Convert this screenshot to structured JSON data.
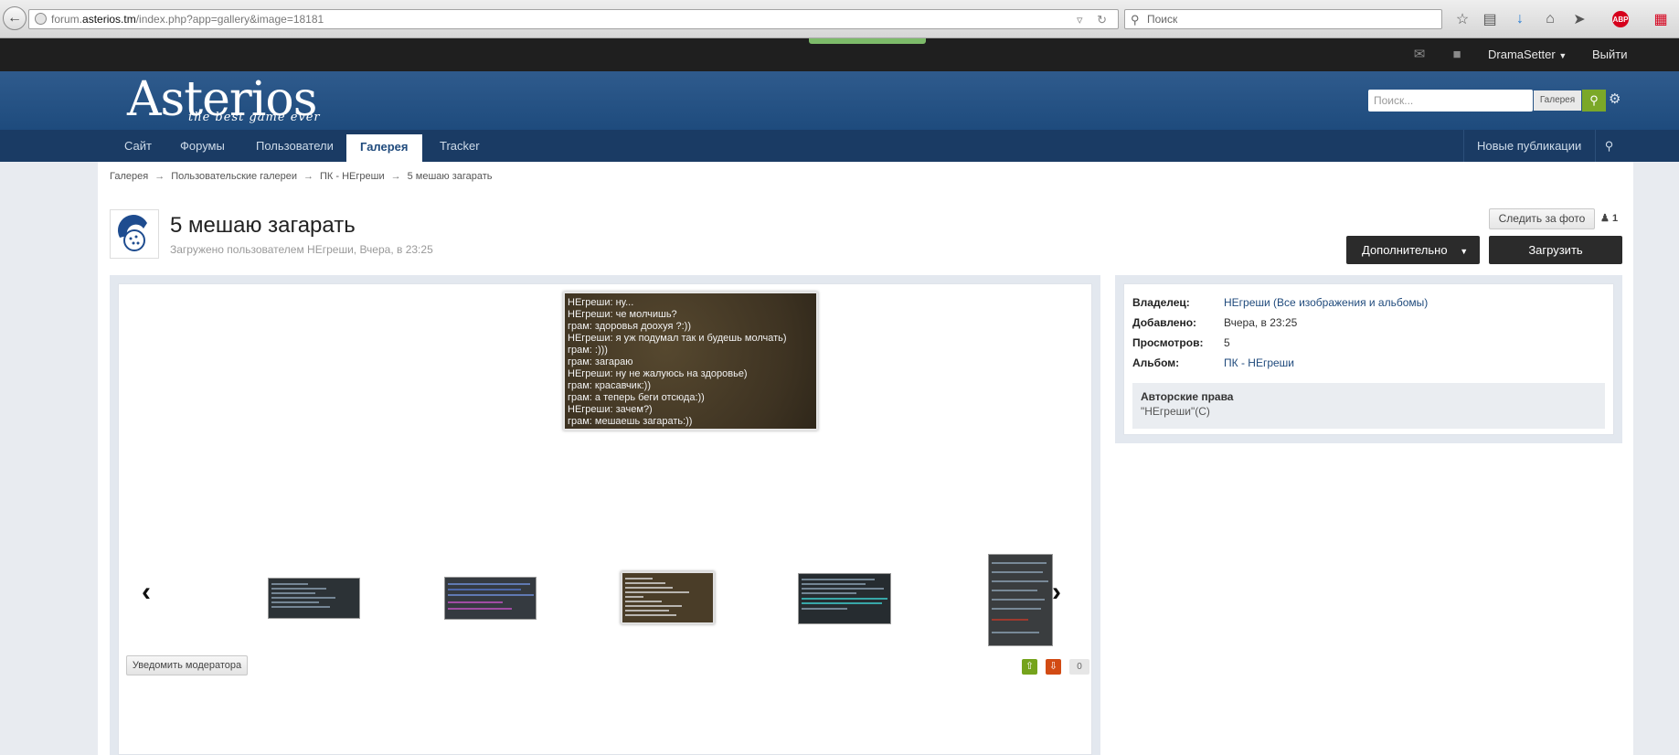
{
  "browser": {
    "url_prefix": "forum.",
    "url_host": "asterios.tm",
    "url_path": "/index.php?app=gallery&image=18181",
    "search_placeholder": "Поиск"
  },
  "userbar": {
    "username": "DramaSetter",
    "logout": "Выйти"
  },
  "header": {
    "logo_text": "Asterios",
    "logo_tagline": "the best game ever",
    "search_placeholder": "Поиск...",
    "search_scope": "Галерея"
  },
  "nav": {
    "items": [
      "Сайт",
      "Форумы",
      "Пользователи",
      "Галерея",
      "Tracker"
    ],
    "active": "Галерея",
    "right_label": "Новые публикации"
  },
  "breadcrumb": [
    "Галерея",
    "Пользовательские галереи",
    "ПК - НЕгреши",
    "5 мешаю загарать"
  ],
  "page": {
    "title": "5 мешаю загарать",
    "subtitle": "Загружено пользователем НЕгреши, Вчера, в 23:25",
    "follow_button": "Следить за фото",
    "followers_count": "1",
    "more_button": "Дополнительно",
    "upload_button": "Загрузить"
  },
  "image": {
    "chat_lines": [
      "НЕгреши: ну...",
      "НЕгреши: че молчишь?",
      "грам: здоровья доохуя ?:))",
      "НЕгреши: я уж подумал так и будешь молчать)",
      "грам: :)))",
      "грам: загараю",
      "НЕгреши: ну не жалуюсь на здоровье)",
      "грам: красавчик:))",
      "грам: а теперь беги отсюда:))",
      "НЕгреши: зачем?)",
      "грам: мешаешь загарать:))"
    ]
  },
  "actions": {
    "report_button": "Уведомить модератора",
    "reputation": "0"
  },
  "info": {
    "owner_label": "Владелец:",
    "owner_value": "НЕгреши (Все изображения и альбомы)",
    "added_label": "Добавлено:",
    "added_value": "Вчера, в 23:25",
    "views_label": "Просмотров:",
    "views_value": "5",
    "album_label": "Альбом:",
    "album_value": "ПК - НЕгреши",
    "copyright_label": "Авторские права",
    "copyright_value": "\"НЕгреши\"(С)"
  },
  "colors": {
    "header_blue": "#2f5b8d",
    "nav_blue": "#1a3b64",
    "search_green": "#7ba828",
    "rep_up": "#75a31c",
    "rep_down": "#d24b14"
  }
}
